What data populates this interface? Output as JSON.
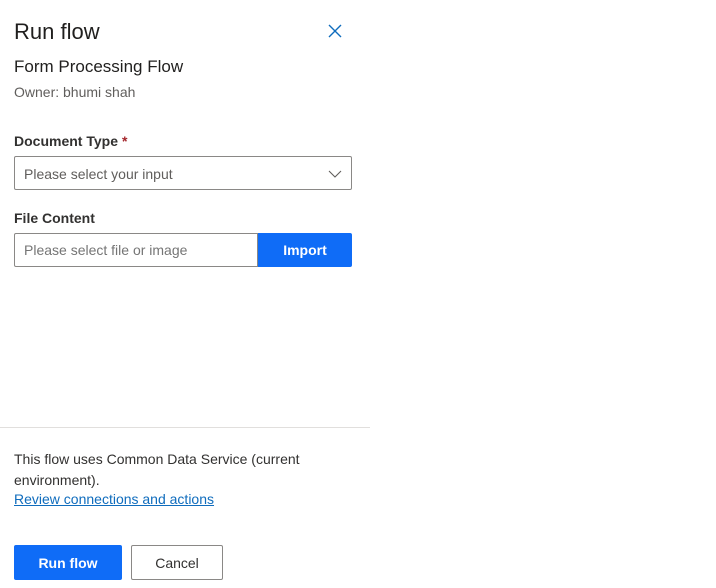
{
  "panel": {
    "title": "Run flow",
    "flow_name": "Form Processing Flow",
    "owner_line": "Owner: bhumi shah"
  },
  "form": {
    "document_type": {
      "label": "Document Type",
      "required_mark": "*",
      "placeholder": "Please select your input"
    },
    "file_content": {
      "label": "File Content",
      "placeholder": "Please select file or image",
      "import_label": "Import"
    }
  },
  "footer": {
    "info_text": "This flow uses Common Data Service (current environment).",
    "review_link": "Review connections and actions",
    "run_button": "Run flow",
    "cancel_button": "Cancel"
  },
  "icons": {
    "close": "close-icon",
    "dropdown": "chevron-down-icon"
  },
  "colors": {
    "accent": "#0f6cf7",
    "link": "#0f6cbd",
    "required": "#a4262c"
  }
}
